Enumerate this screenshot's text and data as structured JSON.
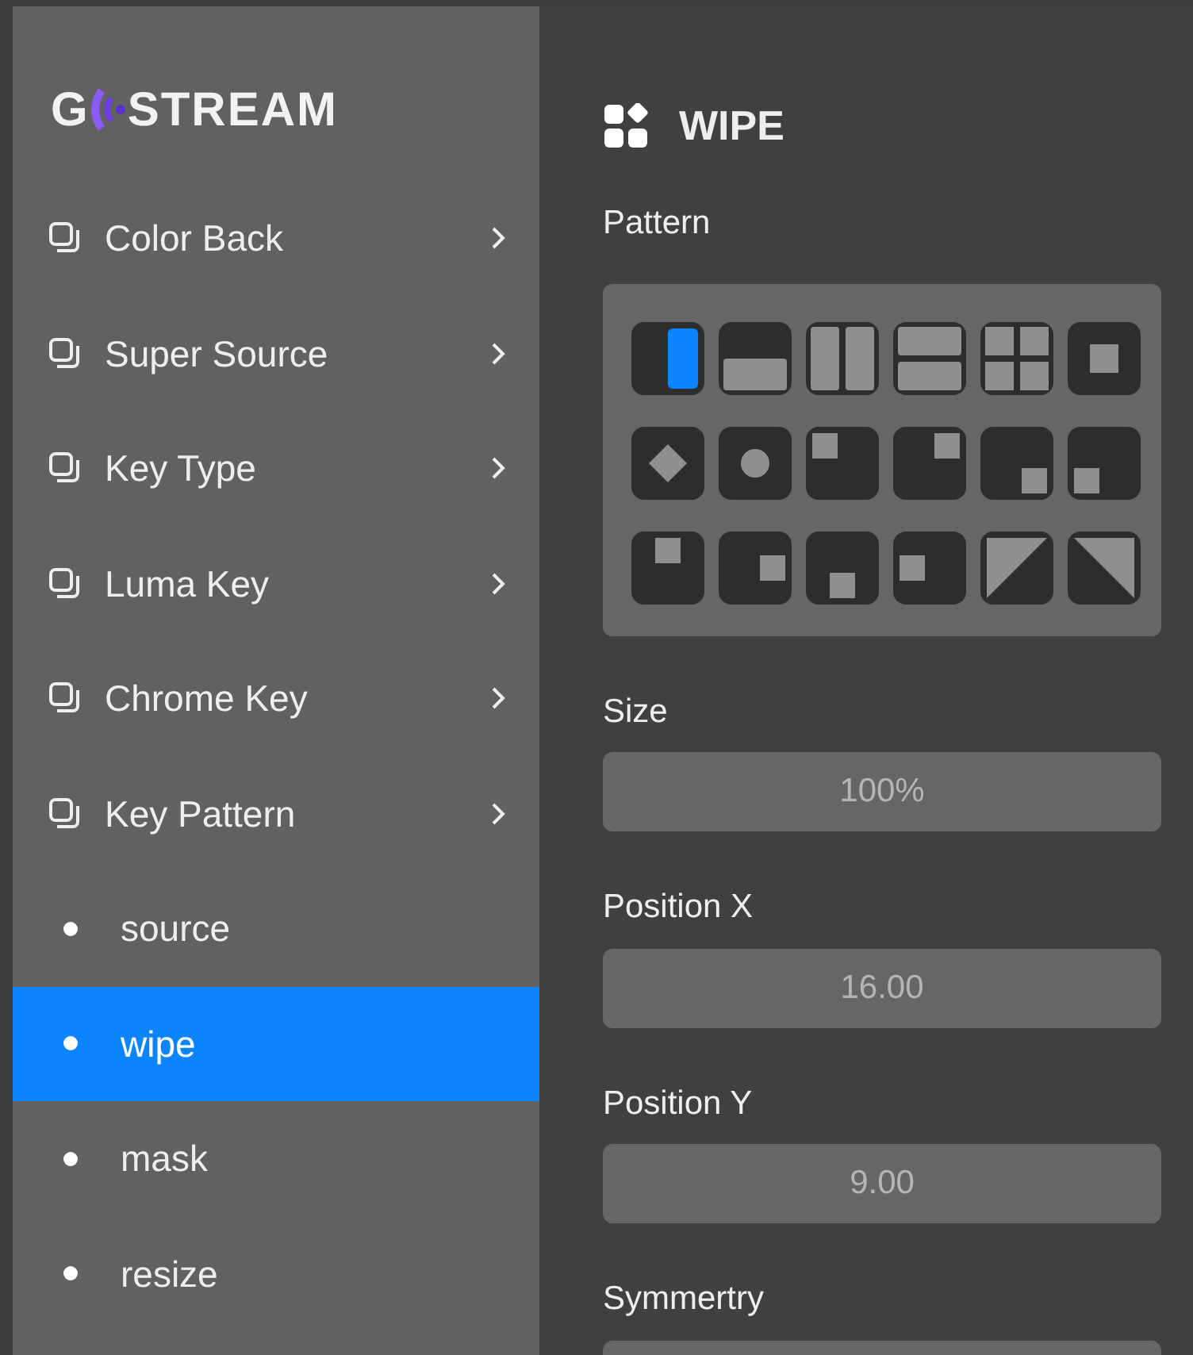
{
  "logo": {
    "left": "G",
    "right": "STREAM"
  },
  "sidebar": {
    "items": [
      {
        "kind": "group",
        "label": "Color Back",
        "selected": false
      },
      {
        "kind": "group",
        "label": "Super Source",
        "selected": false
      },
      {
        "kind": "group",
        "label": "Key Type",
        "selected": false
      },
      {
        "kind": "group",
        "label": "Luma Key",
        "selected": false
      },
      {
        "kind": "group",
        "label": "Chrome Key",
        "selected": false
      },
      {
        "kind": "group",
        "label": "Key Pattern",
        "selected": false
      },
      {
        "kind": "leaf",
        "label": "source",
        "selected": false
      },
      {
        "kind": "leaf",
        "label": "wipe",
        "selected": true
      },
      {
        "kind": "leaf",
        "label": "mask",
        "selected": false
      },
      {
        "kind": "leaf",
        "label": "resize",
        "selected": false
      }
    ]
  },
  "panel": {
    "title": "WIPE",
    "pattern_label": "Pattern",
    "patterns": [
      {
        "kind": "v-split",
        "selected": true
      },
      {
        "kind": "h-split",
        "selected": false
      },
      {
        "kind": "v-bars",
        "selected": false
      },
      {
        "kind": "h-bars",
        "selected": false
      },
      {
        "kind": "quad",
        "selected": false
      },
      {
        "kind": "box",
        "selected": false
      },
      {
        "kind": "diamond",
        "selected": false
      },
      {
        "kind": "circle",
        "selected": false
      },
      {
        "kind": "tl",
        "selected": false
      },
      {
        "kind": "tr",
        "selected": false
      },
      {
        "kind": "br",
        "selected": false
      },
      {
        "kind": "bl",
        "selected": false
      },
      {
        "kind": "t",
        "selected": false
      },
      {
        "kind": "r",
        "selected": false
      },
      {
        "kind": "b",
        "selected": false
      },
      {
        "kind": "l",
        "selected": false
      },
      {
        "kind": "diag-up",
        "selected": false
      },
      {
        "kind": "diag-down",
        "selected": false
      }
    ],
    "fields": [
      {
        "label": "Size",
        "value": "100%"
      },
      {
        "label": "Position X",
        "value": "16.00"
      },
      {
        "label": "Position Y",
        "value": "9.00"
      },
      {
        "label": "Symmertry"
      }
    ]
  }
}
